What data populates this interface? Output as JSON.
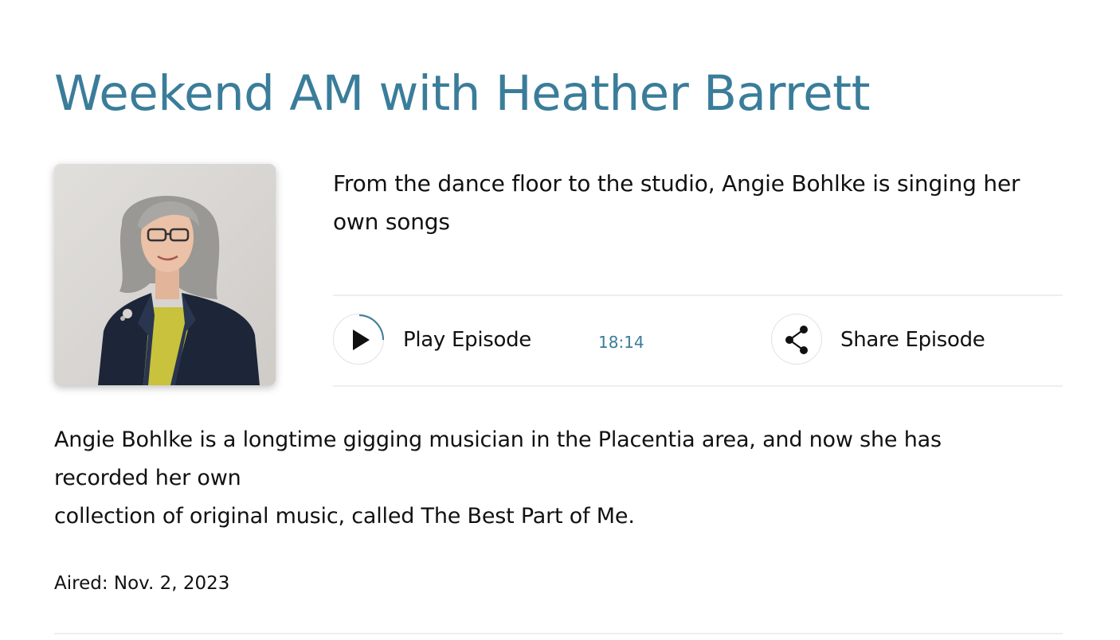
{
  "episode": {
    "show_title": "Weekend AM with Heather Barrett",
    "subtitle": "From the dance floor to the studio, Angie Bohlke is singing her own songs",
    "description_lines": [
      "Angie Bohlke is a longtime gigging musician in the Placentia area, and now she has recorded her own",
      "collection of original music, called The Best Part of Me."
    ],
    "aired": "Aired: Nov. 2, 2023"
  },
  "player": {
    "play_label": "Play Episode",
    "duration": "18:14",
    "share_label": "Share Episode",
    "play_icon": "play-icon",
    "share_icon": "share-icon"
  },
  "colors": {
    "accent": "#3a7d9a",
    "text": "#111111",
    "divider": "#eeeeee"
  }
}
